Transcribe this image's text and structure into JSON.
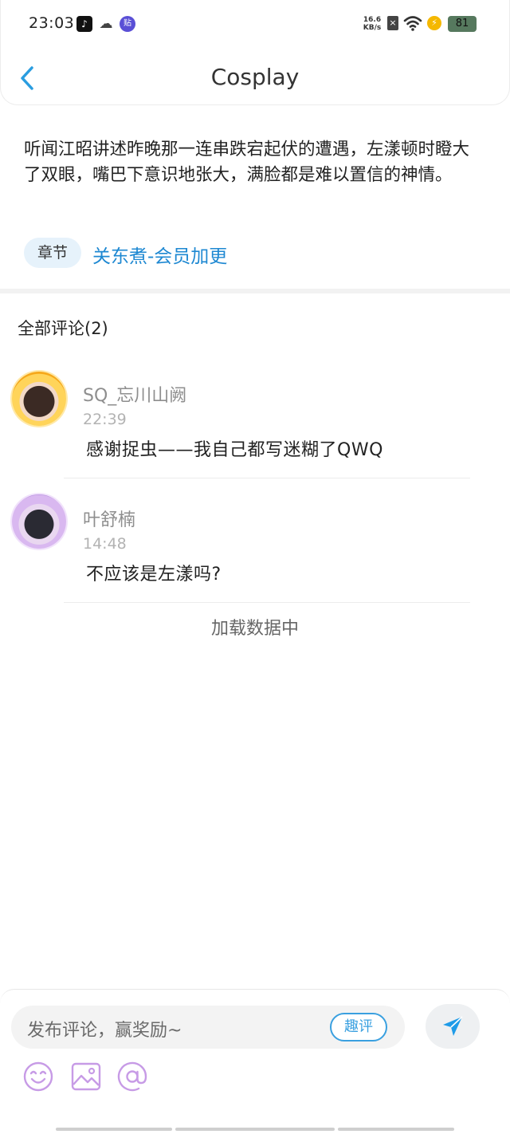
{
  "status_bar": {
    "time": "23:03",
    "net_speed_value": "16.6",
    "net_speed_unit": "KB/s",
    "battery": "81",
    "icons": [
      "tiktok-icon",
      "wechat-icon",
      "tieba-icon",
      "sim-icon",
      "wifi-icon",
      "charging-icon",
      "battery-icon"
    ]
  },
  "header": {
    "title": "Cosplay",
    "back_icon": "chevron-left-icon"
  },
  "quote": {
    "text": "听闻江昭讲述昨晚那一连串跌宕起伏的遭遇，左漾顿时瞪大了双眼，嘴巴下意识地张大，满脸都是难以置信的神情。",
    "chapter_tag": "章节",
    "chapter_name": "关东煮-会员加更"
  },
  "comments_section": {
    "heading": "全部评论(2)",
    "comments": [
      {
        "username": "SQ_忘川山阙",
        "time": "22:39",
        "text": "感谢捉虫——我自己都写迷糊了QWQ"
      },
      {
        "username": "叶舒楠",
        "time": "14:48",
        "text": "不应该是左漾吗?"
      }
    ],
    "loading_text": "加载数据中"
  },
  "composer": {
    "placeholder": "发布评论，赢奖励~",
    "quping_label": "趣评",
    "send_icon": "send-icon",
    "tools": [
      "emoji-icon",
      "image-icon",
      "mention-icon"
    ]
  },
  "colors": {
    "accent": "#1e88d2",
    "tag_bg": "#e6f2fb",
    "tool_purple": "#c79be6"
  }
}
